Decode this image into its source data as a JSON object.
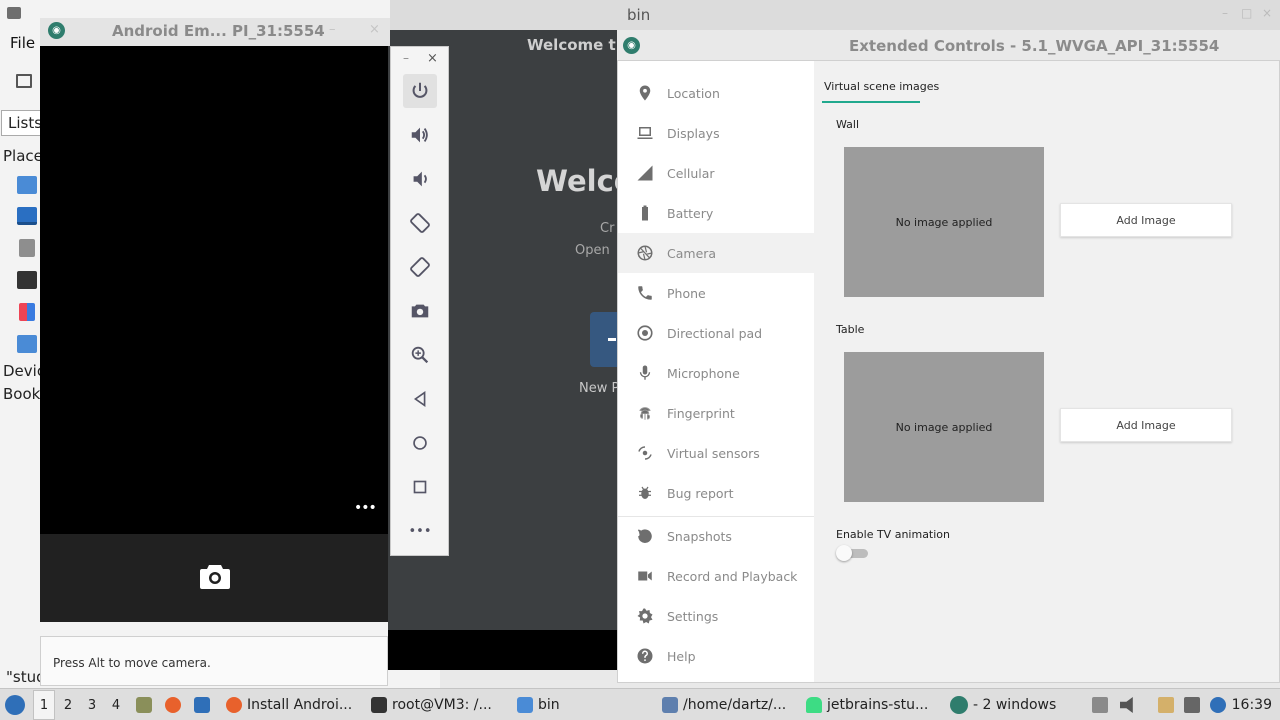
{
  "file_manager": {
    "menu_file": "File",
    "lists_button": "Lists",
    "places_label": "Place",
    "devices_label": "Devic",
    "bookmarks_label": "Book",
    "status_text": "\"stud"
  },
  "bin_window": {
    "title": "bin"
  },
  "welcome_window": {
    "title": "Welcome t",
    "heading": "Welco",
    "line1": "Cr",
    "line2": "Open",
    "new_project": "New P"
  },
  "emulator": {
    "title": "Android Em... PI_31:5554",
    "more_label": "•••",
    "hint": "Press Alt to move camera.",
    "toolbar": {
      "minimize": "–",
      "close": "×",
      "buttons": [
        "power-icon",
        "volume-up-icon",
        "volume-down-icon",
        "rotate-left-icon",
        "rotate-right-icon",
        "screenshot-icon",
        "zoom-icon",
        "back-icon",
        "home-icon",
        "overview-icon",
        "more-icon"
      ],
      "more_label": "•••"
    }
  },
  "extended_controls": {
    "title": "Extended Controls - 5.1_WVGA_API_31:5554",
    "nav": [
      {
        "label": "Location",
        "icon": "location-icon"
      },
      {
        "label": "Displays",
        "icon": "displays-icon"
      },
      {
        "label": "Cellular",
        "icon": "cellular-icon"
      },
      {
        "label": "Battery",
        "icon": "battery-icon"
      },
      {
        "label": "Camera",
        "icon": "camera-icon",
        "selected": true
      },
      {
        "label": "Phone",
        "icon": "phone-icon"
      },
      {
        "label": "Directional pad",
        "icon": "dpad-icon"
      },
      {
        "label": "Microphone",
        "icon": "microphone-icon"
      },
      {
        "label": "Fingerprint",
        "icon": "fingerprint-icon"
      },
      {
        "label": "Virtual sensors",
        "icon": "virtual-sensors-icon"
      },
      {
        "label": "Bug report",
        "icon": "bug-icon"
      },
      {
        "label": "Snapshots",
        "icon": "snapshots-icon"
      },
      {
        "label": "Record and Playback",
        "icon": "record-icon"
      },
      {
        "label": "Settings",
        "icon": "settings-icon"
      },
      {
        "label": "Help",
        "icon": "help-icon"
      }
    ],
    "camera": {
      "tab": "Virtual scene images",
      "wall_label": "Wall",
      "wall_image_text": "No image applied",
      "wall_add_button": "Add Image",
      "table_label": "Table",
      "table_image_text": "No image applied",
      "table_add_button": "Add Image",
      "tv_animation_label": "Enable TV animation",
      "tv_animation_enabled": false
    }
  },
  "taskbar": {
    "workspaces": [
      "1",
      "2",
      "3",
      "4"
    ],
    "active_workspace": "1",
    "tasks": [
      {
        "label": "Install Androi...",
        "icon": "firefox-icon"
      },
      {
        "label": "root@VM3: /...",
        "icon": "terminal-icon"
      },
      {
        "label": "bin",
        "icon": "folder-icon"
      },
      {
        "label": "/home/dartz/...",
        "icon": "editor-icon"
      },
      {
        "label": "jetbrains-stu...",
        "icon": "android-icon"
      },
      {
        "label": "- 2 windows",
        "icon": "emulator-icon"
      }
    ],
    "clock": "16:39"
  },
  "colors": {
    "accent": "#21a98e",
    "welcome_bg": "#3c3f41",
    "emulator_screen": "#000000"
  }
}
